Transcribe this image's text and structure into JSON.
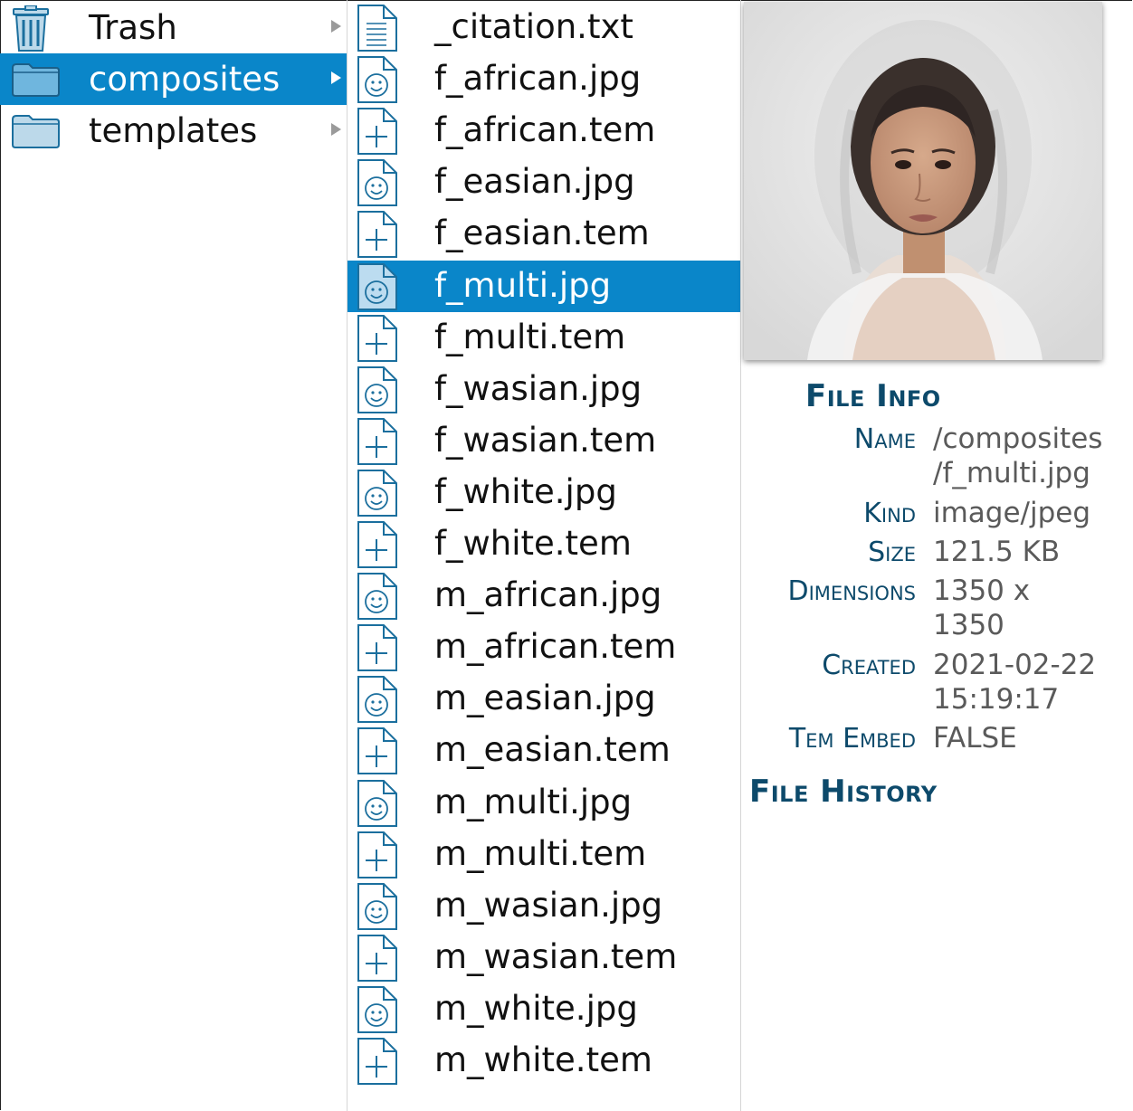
{
  "sidebar": {
    "items": [
      {
        "label": "Trash",
        "icon": "trash-icon"
      },
      {
        "label": "composites",
        "icon": "folder-icon",
        "selected": true
      },
      {
        "label": "templates",
        "icon": "folder-icon"
      }
    ]
  },
  "files": {
    "items": [
      {
        "label": "_citation.txt",
        "icon": "text-file-icon"
      },
      {
        "label": "f_african.jpg",
        "icon": "image-file-icon"
      },
      {
        "label": "f_african.tem",
        "icon": "template-file-icon"
      },
      {
        "label": "f_easian.jpg",
        "icon": "image-file-icon"
      },
      {
        "label": "f_easian.tem",
        "icon": "template-file-icon"
      },
      {
        "label": "f_multi.jpg",
        "icon": "image-file-icon",
        "selected": true
      },
      {
        "label": "f_multi.tem",
        "icon": "template-file-icon"
      },
      {
        "label": "f_wasian.jpg",
        "icon": "image-file-icon"
      },
      {
        "label": "f_wasian.tem",
        "icon": "template-file-icon"
      },
      {
        "label": "f_white.jpg",
        "icon": "image-file-icon"
      },
      {
        "label": "f_white.tem",
        "icon": "template-file-icon"
      },
      {
        "label": "m_african.jpg",
        "icon": "image-file-icon"
      },
      {
        "label": "m_african.tem",
        "icon": "template-file-icon"
      },
      {
        "label": "m_easian.jpg",
        "icon": "image-file-icon"
      },
      {
        "label": "m_easian.tem",
        "icon": "template-file-icon"
      },
      {
        "label": "m_multi.jpg",
        "icon": "image-file-icon"
      },
      {
        "label": "m_multi.tem",
        "icon": "template-file-icon"
      },
      {
        "label": "m_wasian.jpg",
        "icon": "image-file-icon"
      },
      {
        "label": "m_wasian.tem",
        "icon": "template-file-icon"
      },
      {
        "label": "m_white.jpg",
        "icon": "image-file-icon"
      },
      {
        "label": "m_white.tem",
        "icon": "template-file-icon"
      }
    ]
  },
  "info": {
    "title": "File Info",
    "name_label": "Name",
    "name_line1": "/composites",
    "name_line2": "/f_multi.jpg",
    "kind_label": "Kind",
    "kind_value": "image/jpeg",
    "size_label": "Size",
    "size_value": "121.5 KB",
    "dimensions_label": "Dimensions",
    "dimensions_line1": "1350 x",
    "dimensions_line2": "1350",
    "created_label": "Created",
    "created_line1": "2021-02-22",
    "created_line2": "15:19:17",
    "tem_embed_label": "Tem Embed",
    "tem_embed_value": "FALSE",
    "history_title": "File History"
  },
  "colors": {
    "selection": "#0a86c9",
    "icon_stroke": "#1b6f9e",
    "heading": "#0d4a6b"
  }
}
